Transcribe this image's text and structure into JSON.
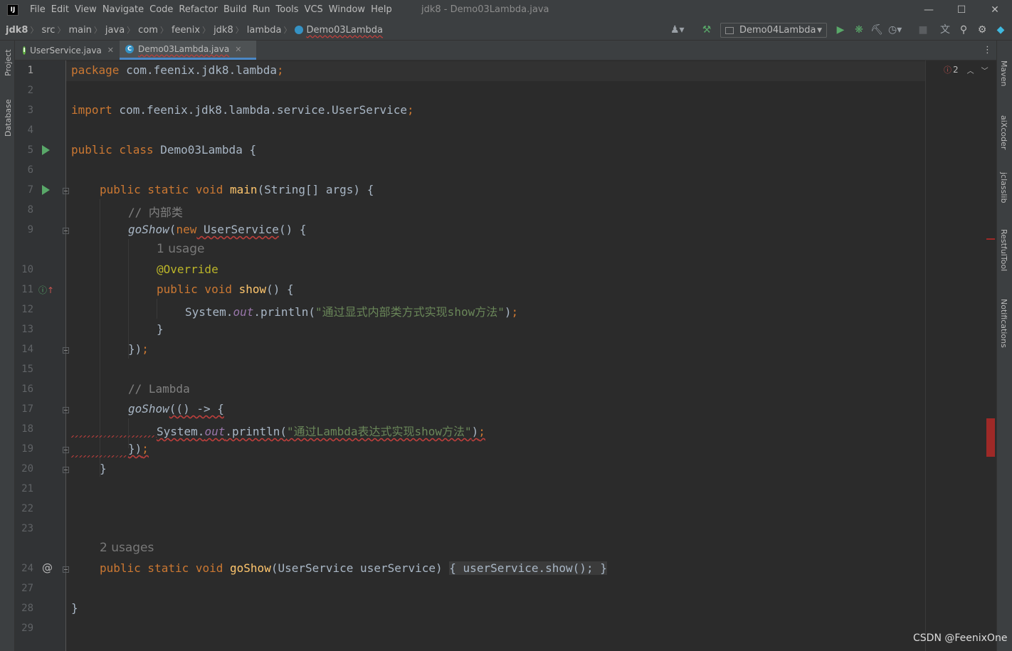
{
  "window": {
    "title": "jdk8 - Demo03Lambda.java",
    "logo": "IJ",
    "controls": {
      "minimize": "—",
      "maximize": "☐",
      "close": "✕"
    }
  },
  "menu": [
    "File",
    "Edit",
    "View",
    "Navigate",
    "Code",
    "Refactor",
    "Build",
    "Run",
    "Tools",
    "VCS",
    "Window",
    "Help"
  ],
  "breadcrumb": [
    "jdk8",
    "src",
    "main",
    "java",
    "com",
    "feenix",
    "jdk8",
    "lambda",
    "Demo03Lambda"
  ],
  "toolbar": {
    "run_config": "Demo04Lambda",
    "icons": [
      "user-icon",
      "hammer-icon",
      "run-icon",
      "debug-icon",
      "coverage-icon",
      "profile-icon",
      "stop-icon",
      "translate-icon",
      "search-icon",
      "gear-icon",
      "jetbrains-icon"
    ]
  },
  "tabs": [
    {
      "label": "UserService.java",
      "icon": "interface-icon",
      "active": false
    },
    {
      "label": "Demo03Lambda.java",
      "icon": "class-icon",
      "active": true
    }
  ],
  "left_tools": [
    "Project",
    "Database"
  ],
  "right_tools": [
    "Maven",
    "aiXcoder",
    "jclasslib",
    "RestfulTool",
    "Notifications"
  ],
  "inspection": {
    "error_count": "2"
  },
  "line_numbers": [
    "1",
    "2",
    "3",
    "4",
    "5",
    "6",
    "7",
    "8",
    "9",
    "10",
    "11",
    "12",
    "13",
    "14",
    "15",
    "16",
    "17",
    "18",
    "19",
    "20",
    "21",
    "22",
    "23",
    "24",
    "27",
    "28",
    "29"
  ],
  "hints": {
    "usage_1": "1 usage",
    "usage_2": "2 usages"
  },
  "code": {
    "l1_kw": "package",
    "l1_rest": " com.feenix.jdk8.lambda",
    "l1_semi": ";",
    "l3_kw": "import",
    "l3_rest": " com.feenix.jdk8.lambda.service.UserService",
    "l3_semi": ";",
    "l5_kw": "public class",
    "l5_rest": " Demo03Lambda {",
    "l7_kw": "public static void",
    "l7_fn": " main",
    "l7_rest": "(String[] args) {",
    "l8_cm": "// 内部类",
    "l9_fn": "goShow",
    "l9_p": "(",
    "l9_kw": "new",
    "l9_type": " UserService",
    "l9_rest": "() {",
    "l10_ann": "@Override",
    "l11_kw": "public void",
    "l11_fn": " show",
    "l11_rest": "() {",
    "l12_a": "System.",
    "l12_field": "out",
    "l12_b": ".println(",
    "l12_str": "\"通过显式内部类方式实现show方法\"",
    "l12_c": ")",
    "l12_semi": ";",
    "l13": "}",
    "l14_a": "})",
    "l14_semi": ";",
    "l16_cm": "// Lambda",
    "l17_fn": "goShow",
    "l17_rest": "(() -> {",
    "l18_a": "System.",
    "l18_field": "out",
    "l18_b": ".println(",
    "l18_str": "\"通过Lambda表达式实现show方法\"",
    "l18_c": ")",
    "l18_semi": ";",
    "l19_a": "})",
    "l19_semi": ";",
    "l20": "}",
    "l24_kw": "public static void",
    "l24_fn": " goShow",
    "l24_rest": "(UserService userService) ",
    "l24_fold": "{ userService.show(); }",
    "l28": "}"
  },
  "watermark": "CSDN @FeenixOne"
}
